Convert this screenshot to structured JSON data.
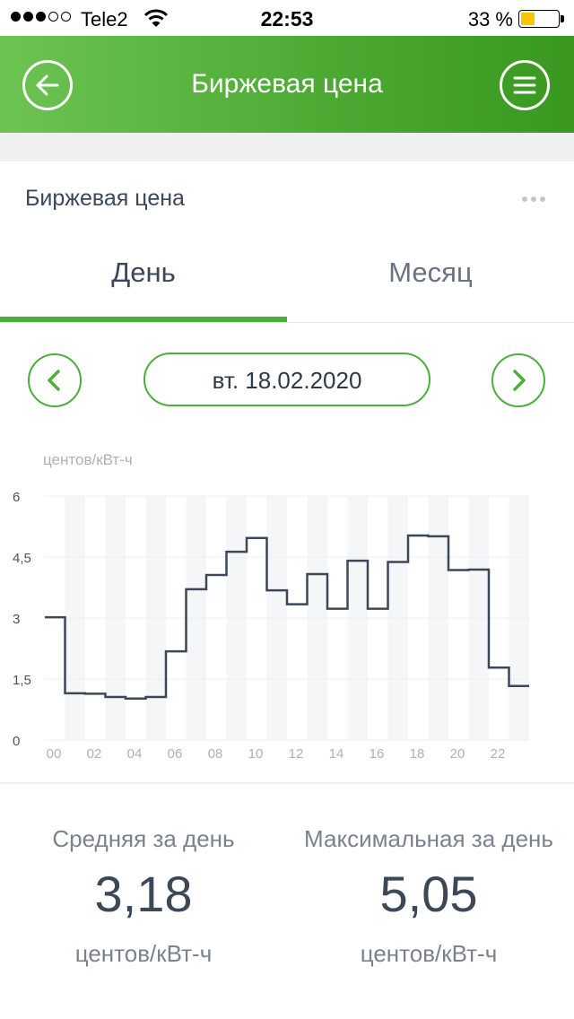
{
  "status_bar": {
    "carrier": "Tele2",
    "time": "22:53",
    "battery": "33 %",
    "battery_level": 0.33
  },
  "header": {
    "title": "Биржевая цена"
  },
  "widget": {
    "title": "Биржевая цена"
  },
  "tabs": [
    {
      "label": "День",
      "active": true
    },
    {
      "label": "Месяц",
      "active": false
    }
  ],
  "date_nav": {
    "date": "вт. 18.02.2020"
  },
  "colors": {
    "accent": "#4caf3c",
    "line": "#3c4858",
    "header_light": "#6cc352",
    "header_dark": "#39981f"
  },
  "chart_data": {
    "type": "line",
    "step": true,
    "ylabel": "центов/кВт-ч",
    "ylim": [
      0,
      6
    ],
    "yticks": [
      0,
      1.5,
      3,
      4.5,
      6
    ],
    "ytick_labels": [
      "0",
      "1,5",
      "3",
      "4,5",
      "6"
    ],
    "xlim": [
      0,
      24
    ],
    "xticks": [
      0,
      2,
      4,
      6,
      8,
      10,
      12,
      14,
      16,
      18,
      20,
      22
    ],
    "xtick_labels": [
      "00",
      "02",
      "04",
      "06",
      "08",
      "10",
      "12",
      "14",
      "16",
      "18",
      "20",
      "22"
    ],
    "hours": [
      0,
      1,
      2,
      3,
      4,
      5,
      6,
      7,
      8,
      9,
      10,
      11,
      12,
      13,
      14,
      15,
      16,
      17,
      18,
      19,
      20,
      21,
      22,
      23
    ],
    "values": [
      3.02,
      1.15,
      1.14,
      1.06,
      1.02,
      1.06,
      2.18,
      3.71,
      4.06,
      4.63,
      4.97,
      3.68,
      3.34,
      4.08,
      3.23,
      4.41,
      3.23,
      4.38,
      5.03,
      5.01,
      4.18,
      4.19,
      1.78,
      1.33
    ],
    "grid": true,
    "alternating_column_shading": true
  },
  "stats": {
    "avg": {
      "label": "Средняя за день",
      "value": "3,18",
      "unit": "центов/кВт-ч"
    },
    "max": {
      "label": "Максимальная за день",
      "value": "5,05",
      "unit": "центов/кВт-ч"
    }
  }
}
